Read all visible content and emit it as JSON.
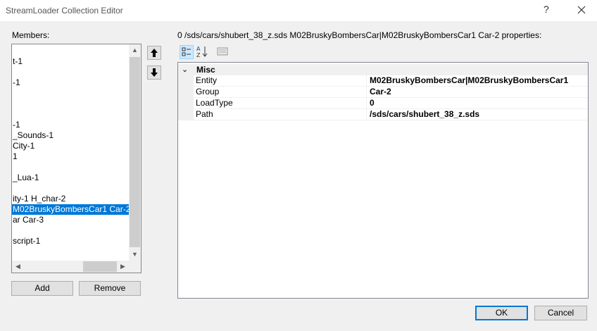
{
  "window": {
    "title": "StreamLoader Collection Editor",
    "help_glyph": "?",
    "close_icon": "close-icon"
  },
  "members": {
    "label": "Members:",
    "items": [
      {
        "text": "t-1",
        "selected": false
      },
      {
        "text": "-1",
        "selected": false
      },
      {
        "text": "-1",
        "selected": false
      },
      {
        "text": "_Sounds-1",
        "selected": false
      },
      {
        "text": "City-1",
        "selected": false
      },
      {
        "text": "1",
        "selected": false
      },
      {
        "text": "_Lua-1",
        "selected": false
      },
      {
        "text": "ity-1 H_char-2",
        "selected": false
      },
      {
        "text": "M02BruskyBombersCar1 Car-2",
        "selected": true
      },
      {
        "text": "ar Car-3",
        "selected": false
      },
      {
        "text": "script-1",
        "selected": false
      }
    ],
    "move_up_icon": "arrow-up-icon",
    "move_down_icon": "arrow-down-icon"
  },
  "buttons": {
    "add": "Add",
    "remove": "Remove",
    "ok": "OK",
    "cancel": "Cancel"
  },
  "properties": {
    "header": "0 /sds/cars/shubert_38_z.sds M02BruskyBombersCar|M02BruskyBombersCar1 Car-2 properties:",
    "toolbar": [
      "categorized-icon",
      "alphabetical-icon",
      "property-pages-icon"
    ],
    "category": "Misc",
    "rows": [
      {
        "name": "Entity",
        "value": "M02BruskyBombersCar|M02BruskyBombersCar1"
      },
      {
        "name": "Group",
        "value": "Car-2"
      },
      {
        "name": "LoadType",
        "value": "0"
      },
      {
        "name": "Path",
        "value": "/sds/cars/shubert_38_z.sds"
      }
    ]
  },
  "colors": {
    "selection": "#0078d7",
    "accent_border": "#0078d7"
  }
}
